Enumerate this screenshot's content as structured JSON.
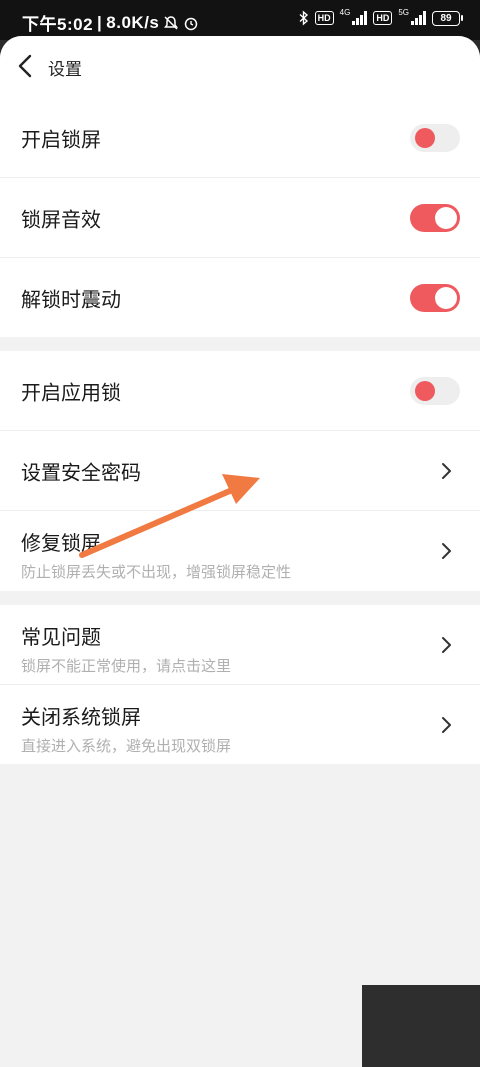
{
  "status": {
    "time": "下午5:02",
    "speed": "8.0K/s",
    "net1": "4G",
    "net2": "5G",
    "hd": "HD",
    "battery": "89"
  },
  "header": {
    "title": "设置"
  },
  "groups": [
    {
      "items": [
        {
          "label": "开启锁屏",
          "control": "toggle",
          "state": "off"
        },
        {
          "label": "锁屏音效",
          "control": "toggle",
          "state": "on"
        },
        {
          "label": "解锁时震动",
          "control": "toggle",
          "state": "on"
        }
      ]
    },
    {
      "items": [
        {
          "label": "开启应用锁",
          "control": "toggle",
          "state": "off"
        },
        {
          "label": "设置安全密码",
          "control": "chevron"
        },
        {
          "label": "修复锁屏",
          "subtitle": "防止锁屏丢失或不出现，增强锁屏稳定性",
          "control": "chevron"
        }
      ]
    },
    {
      "items": [
        {
          "label": "常见问题",
          "subtitle": "锁屏不能正常使用，请点击这里",
          "control": "chevron"
        },
        {
          "label": "关闭系统锁屏",
          "subtitle": "直接进入系统，避免出现双锁屏",
          "control": "chevron"
        }
      ]
    }
  ],
  "colors": {
    "accent": "#ef5a5f",
    "annotation_arrow": "#f07a42",
    "background": "#f2f2f2"
  },
  "icons": {
    "back": "chevron-left-icon",
    "row": "chevron-right-icon",
    "bluetooth": "bluetooth-icon",
    "bell": "bell-off-icon",
    "alarm": "alarm-icon"
  }
}
